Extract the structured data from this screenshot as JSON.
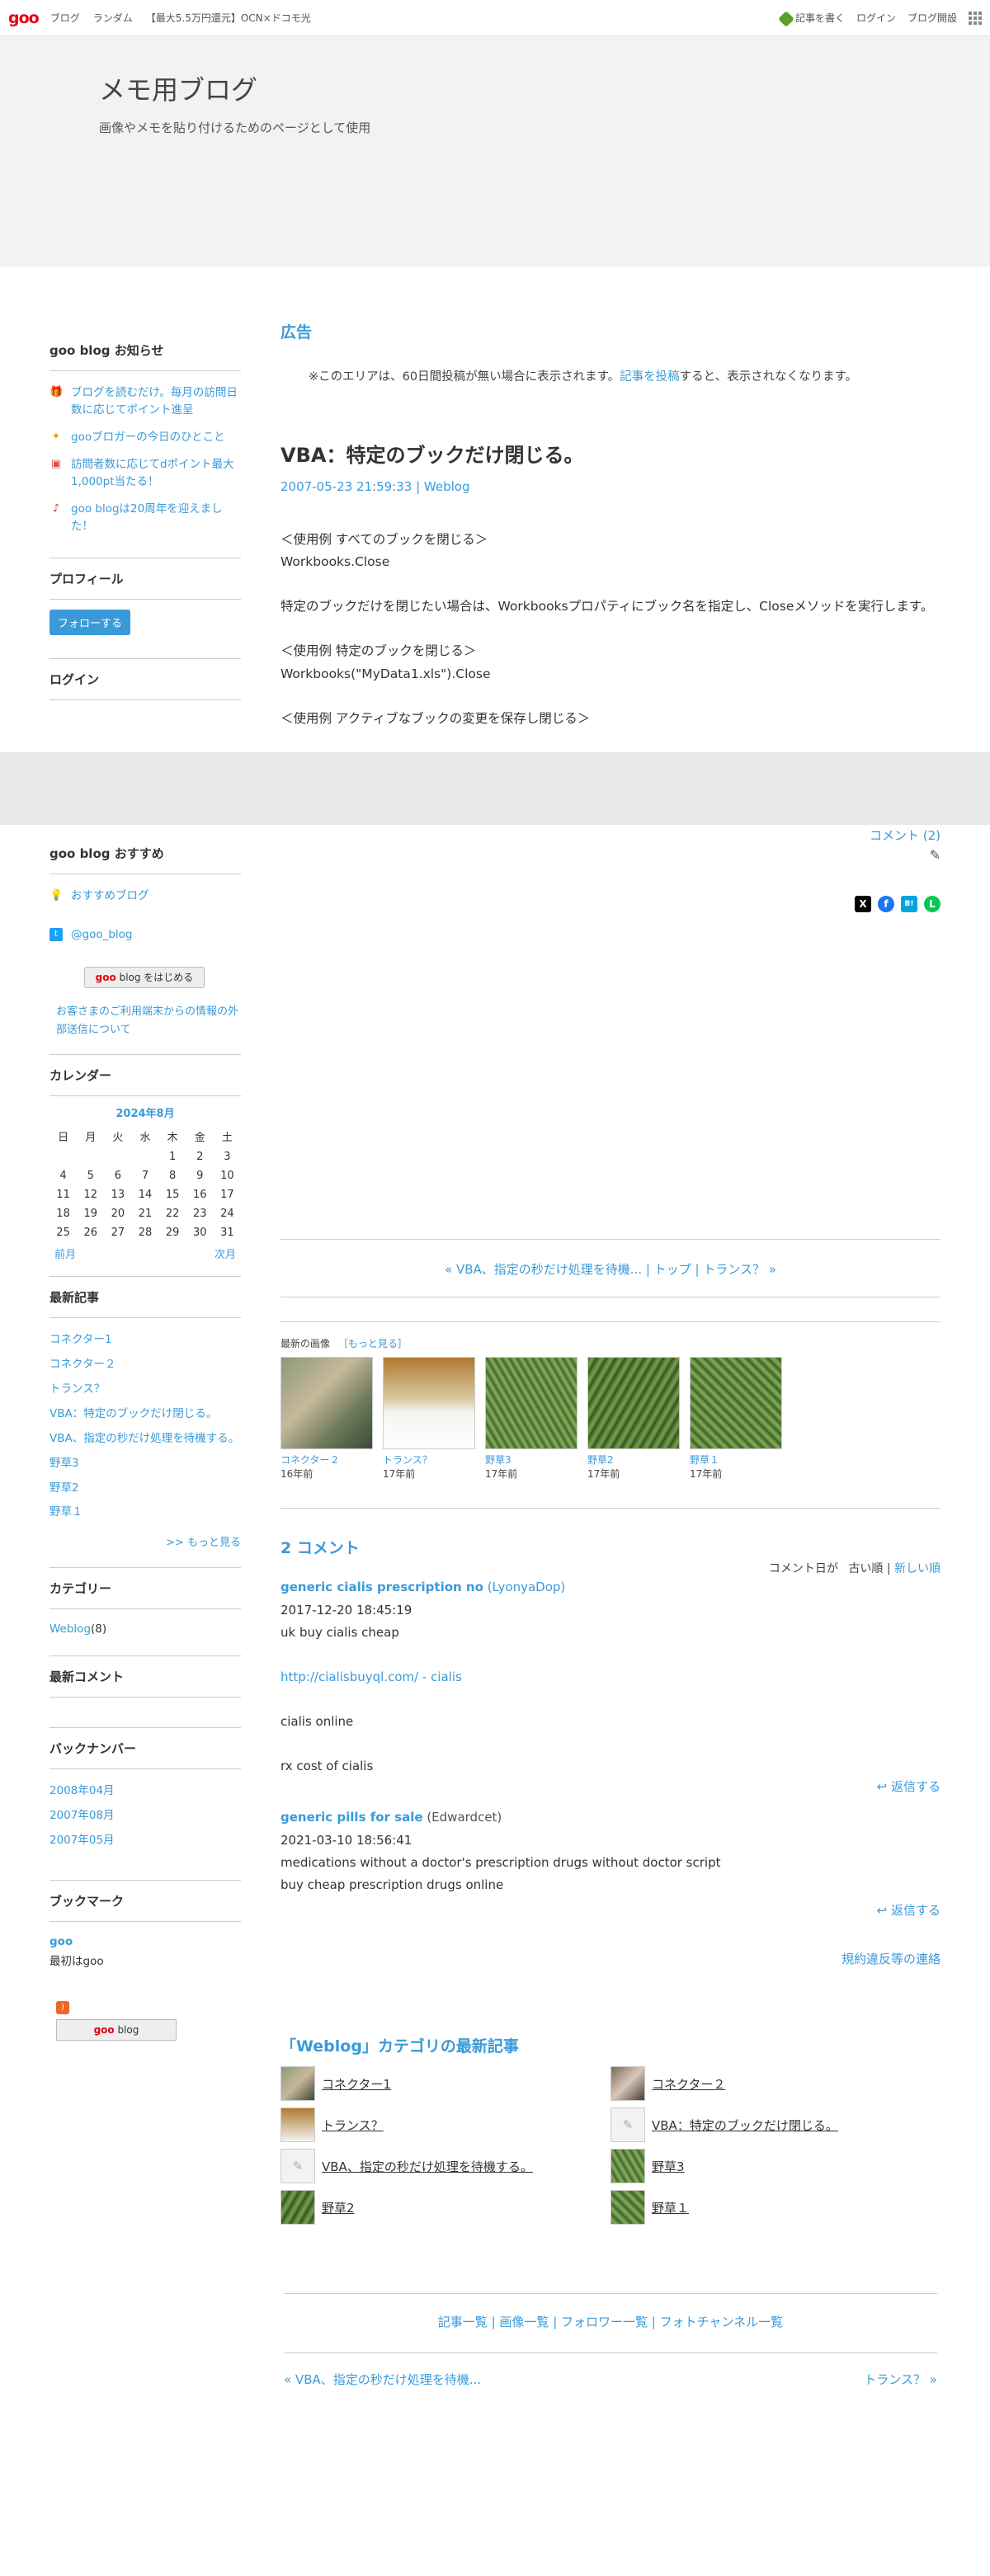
{
  "topbar": {
    "logo": "goo",
    "nav": [
      "ブログ",
      "ランダム",
      "【最大5.5万円還元】OCN×ドコモ光"
    ],
    "write": "記事を書く",
    "login": "ログイン",
    "open_blog": "ブログ開設"
  },
  "header": {
    "title": "メモ用ブログ",
    "description": "画像やメモを貼り付けるためのページとして使用"
  },
  "sidebar": {
    "news_heading": "goo blog お知らせ",
    "news": [
      {
        "icon": "gift-icon",
        "text": "ブログを読むだけ。毎月の訪問日数に応じてポイント進呈"
      },
      {
        "icon": "sparkle-icon",
        "text": "gooブロガーの今日のひとこと"
      },
      {
        "icon": "gift-icon",
        "text": "訪問者数に応じてdポイント最大1,000pt当たる！"
      },
      {
        "icon": "music-icon",
        "text": "goo blogは20周年を迎えました！"
      }
    ],
    "profile_heading": "プロフィール",
    "follow_button": "フォローする",
    "login_heading": "ログイン",
    "recommend_heading": "goo blog おすすめ",
    "recommend_blog": "おすすめブログ",
    "twitter": "@goo_blog",
    "start_banner_text": "blog をはじめる",
    "info_link": "お客さまのご利用端末からの情報の外部送信について",
    "calendar_heading": "カレンダー",
    "calendar": {
      "caption": "2024年8月",
      "weekdays": [
        "日",
        "月",
        "火",
        "水",
        "木",
        "金",
        "土"
      ],
      "weeks": [
        [
          "",
          "",
          "",
          "",
          "1",
          "2",
          "3"
        ],
        [
          "4",
          "5",
          "6",
          "7",
          "8",
          "9",
          "10"
        ],
        [
          "11",
          "12",
          "13",
          "14",
          "15",
          "16",
          "17"
        ],
        [
          "18",
          "19",
          "20",
          "21",
          "22",
          "23",
          "24"
        ],
        [
          "25",
          "26",
          "27",
          "28",
          "29",
          "30",
          "31"
        ]
      ],
      "prev": "前月",
      "next": "次月"
    },
    "recent_heading": "最新記事",
    "recent": [
      "コネクター1",
      "コネクター２",
      "トランス？",
      "VBA：特定のブックだけ閉じる。",
      "VBA、指定の秒だけ処理を待機する。",
      "野草3",
      "野草2",
      "野草１"
    ],
    "more": ">> もっと見る",
    "category_heading": "カテゴリー",
    "category": "Weblog",
    "category_count": "(8)",
    "recent_comments_heading": "最新コメント",
    "backnumber_heading": "バックナンバー",
    "backnumbers": [
      "2008年04月",
      "2007年08月",
      "2007年05月"
    ],
    "bookmark_heading": "ブックマーク",
    "bookmark_name": "goo",
    "bookmark_desc": "最初はgoo",
    "footer_banner_text": "blog"
  },
  "main": {
    "ad_heading": "広告",
    "ad_note_before": "※このエリアは、60日間投稿が無い場合に表示されます。",
    "ad_note_link": "記事を投稿",
    "ad_note_after": "すると、表示されなくなります。",
    "post": {
      "title": "VBA：特定のブックだけ閉じる。",
      "date": "2007-05-23 21:59:33",
      "separator": " | ",
      "category": "Weblog",
      "paragraphs": [
        "＜使用例 すべてのブックを閉じる＞",
        "Workbooks.Close",
        "",
        "特定のブックだけを閉じたい場合は、Workbooksプロパティにブック名を指定し、Closeメソッドを実行します。",
        "",
        "＜使用例 特定のブックを閉じる＞",
        "Workbooks(\"MyData1.xls\").Close",
        "",
        "＜使用例 アクティブなブックの変更を保存し閉じる＞"
      ],
      "comment_link": "コメント (2)"
    },
    "share": {
      "x": "X",
      "facebook": "f",
      "hatena": "B!",
      "line": "L"
    },
    "post_nav": {
      "prev": "« VBA、指定の秒だけ処理を待機...",
      "sep1": " | ",
      "top": "トップ",
      "sep2": " | ",
      "next": "トランス？ »"
    },
    "gallery": {
      "heading": "最新の画像",
      "more": "［もっと見る］",
      "items": [
        {
          "caption": "コネクター２",
          "age": "16年前"
        },
        {
          "caption": "トランス？",
          "age": "17年前"
        },
        {
          "caption": "野草3",
          "age": "17年前"
        },
        {
          "caption": "野草2",
          "age": "17年前"
        },
        {
          "caption": "野草１",
          "age": "17年前"
        }
      ]
    },
    "comments": {
      "heading": "2 コメント",
      "sort_label": "コメント日が",
      "sort_old": "古い順",
      "sort_sep": " | ",
      "sort_new": "新しい順",
      "list": [
        {
          "name": "generic cialis prescription no",
          "author": "(LyonyaDop)",
          "date": "2017-12-20 18:45:19",
          "lines": [
            "uk buy cialis cheap",
            "",
            "http://cialisbuyql.com/ - cialis",
            "",
            "cialis online",
            "",
            "rx cost of cialis"
          ],
          "reply": "返信する"
        },
        {
          "name": "generic pills for sale",
          "author": "(Edwardcet)",
          "date": "2021-03-10 18:56:41",
          "lines": [
            "medications without a doctor's prescription drugs without doctor script",
            "buy cheap prescription drugs online"
          ],
          "reply": "返信する"
        }
      ],
      "report": "規約違反等の連絡"
    },
    "category_latest": {
      "heading": "「Weblog」カテゴリの最新記事",
      "items": [
        "コネクター1",
        "コネクター２",
        "トランス？",
        "VBA：特定のブックだけ閉じる。",
        "VBA、指定の秒だけ処理を待機する。",
        "野草3",
        "野草2",
        "野草１"
      ]
    },
    "footer_links": {
      "articles": "記事一覧",
      "sep1": " | ",
      "images": "画像一覧",
      "sep2": " | ",
      "followers": "フォロワー一覧",
      "sep3": " | ",
      "photo": "フォトチャンネル一覧"
    },
    "bottom_nav": {
      "prev": "« VBA、指定の秒だけ処理を待機...",
      "next": "トランス？ »"
    }
  }
}
